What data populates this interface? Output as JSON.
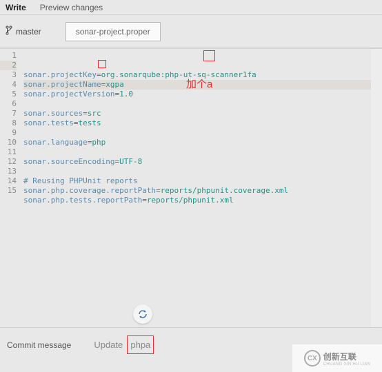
{
  "tabs": {
    "write": "Write",
    "preview": "Preview changes"
  },
  "branch": {
    "name": "master"
  },
  "filename": "sonar-project.proper",
  "lines": [
    {
      "n": 1,
      "key": "sonar.projectKey",
      "val": "org.sonarqube:php-ut-sq-scanner1fa"
    },
    {
      "n": 2,
      "key": "sonar.projectName",
      "val": "xgpa",
      "hl": true
    },
    {
      "n": 3,
      "key": "sonar.projectVersion",
      "val": "1.0"
    },
    {
      "n": 4
    },
    {
      "n": 5,
      "key": "sonar.sources",
      "val": "src"
    },
    {
      "n": 6,
      "key": "sonar.tests",
      "val": "tests"
    },
    {
      "n": 7
    },
    {
      "n": 8,
      "key": "sonar.language",
      "val": "php"
    },
    {
      "n": 9
    },
    {
      "n": 10,
      "key": "sonar.sourceEncoding",
      "val": "UTF-8"
    },
    {
      "n": 11
    },
    {
      "n": 12,
      "comment": "# Reusing PHPUnit reports"
    },
    {
      "n": 13,
      "key": "sonar.php.coverage.reportPath",
      "val": "reports/phpunit.coverage.xml"
    },
    {
      "n": 14,
      "key": "sonar.php.tests.reportPath",
      "val": "reports/phpunit.xml"
    },
    {
      "n": 15
    }
  ],
  "annotation": "加个a",
  "commit": {
    "label": "Commit message",
    "prefix": "Update",
    "highlight": "phpa"
  },
  "watermark": {
    "brand": "创新互联",
    "sub": "CHUANG XIN HU LIAN"
  }
}
